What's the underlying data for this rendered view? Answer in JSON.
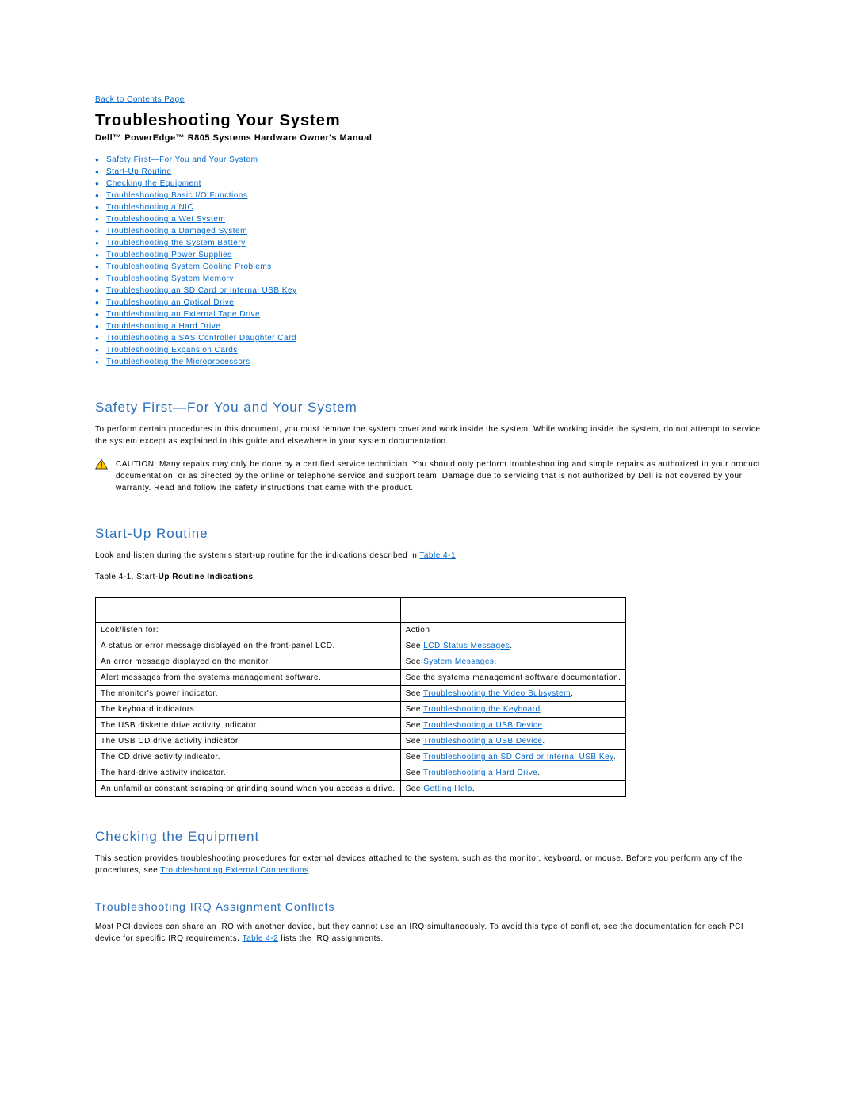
{
  "back_link": "Back to Contents Page",
  "title": "Troubleshooting Your System",
  "subtitle": "Dell™ PowerEdge™ R805 Systems Hardware Owner's Manual",
  "toc": [
    "Safety First—For You and Your System",
    "Start-Up Routine",
    "Checking the Equipment",
    "Troubleshooting Basic I/O Functions",
    "Troubleshooting a NIC",
    "Troubleshooting a Wet System",
    "Troubleshooting a Damaged System",
    "Troubleshooting the System Battery",
    "Troubleshooting Power Supplies",
    "Troubleshooting System Cooling Problems",
    "Troubleshooting System Memory",
    "Troubleshooting an SD Card or Internal USB Key",
    "Troubleshooting an Optical Drive",
    "Troubleshooting an External Tape Drive",
    "Troubleshooting a Hard Drive",
    "Troubleshooting a SAS Controller Daughter Card",
    "Troubleshooting Expansion Cards",
    "Troubleshooting the Microprocessors"
  ],
  "safety": {
    "heading": "Safety First—For You and Your System",
    "para": "To perform certain procedures in this document, you must remove the system cover and work inside the system. While working inside the system, do not attempt to service the system except as explained in this guide and elsewhere in your system documentation.",
    "caution_label": "CAUTION:",
    "caution_body": " Many repairs may only be done by a certified service technician. You should only perform troubleshooting and simple repairs as authorized in your product documentation, or as directed by the online or telephone service and support team. Damage due to servicing that is not authorized by Dell is not covered by your warranty. Read and follow the safety instructions that came with the product."
  },
  "startup": {
    "heading": "Start-Up Routine",
    "para_pre": "Look and listen during the system's start-up routine for the indications described in ",
    "para_link": "Table 4-1",
    "para_post": ".",
    "caption_pre": "Table 4-1. Start-",
    "caption_bold": "Up Routine Indications",
    "col1": "Look/listen for:",
    "col2": "Action",
    "rows": [
      {
        "l": "A status or error message displayed on the front-panel LCD.",
        "a_pre": "See ",
        "a_link": "LCD Status Messages",
        "a_post": "."
      },
      {
        "l": "An error message displayed on the monitor.",
        "a_pre": "See ",
        "a_link": "System Messages",
        "a_post": "."
      },
      {
        "l": "Alert messages from the systems management software.",
        "a_pre": "See the systems management software documentation.",
        "a_link": "",
        "a_post": ""
      },
      {
        "l": "The monitor's power indicator.",
        "a_pre": "See ",
        "a_link": "Troubleshooting the Video Subsystem",
        "a_post": "."
      },
      {
        "l": "The keyboard indicators.",
        "a_pre": "See ",
        "a_link": "Troubleshooting the Keyboard",
        "a_post": "."
      },
      {
        "l": "The USB diskette drive activity indicator.",
        "a_pre": "See ",
        "a_link": "Troubleshooting a USB Device",
        "a_post": "."
      },
      {
        "l": "The USB CD drive activity indicator.",
        "a_pre": "See ",
        "a_link": "Troubleshooting a USB Device",
        "a_post": "."
      },
      {
        "l": "The CD drive activity indicator.",
        "a_pre": "See ",
        "a_link": "Troubleshooting an SD Card or Internal USB Key",
        "a_post": "."
      },
      {
        "l": "The hard-drive activity indicator.",
        "a_pre": "See ",
        "a_link": "Troubleshooting a Hard Drive",
        "a_post": "."
      },
      {
        "l": "An unfamiliar constant scraping or grinding sound when you access a drive.",
        "a_pre": "See ",
        "a_link": "Getting Help",
        "a_post": "."
      }
    ]
  },
  "checking": {
    "heading": "Checking the Equipment",
    "para_pre": "This section provides troubleshooting procedures for external devices attached to the system, such as the monitor, keyboard, or mouse. Before you perform any of the procedures, see ",
    "para_link": "Troubleshooting External Connections",
    "para_post": "."
  },
  "irq": {
    "heading": "Troubleshooting IRQ Assignment Conflicts",
    "para_pre": "Most PCI devices can share an IRQ with another device, but they cannot use an IRQ simultaneously. To avoid this type of conflict, see the documentation for each PCI device for specific IRQ requirements. ",
    "para_link": "Table 4-2",
    "para_post": " lists the IRQ assignments."
  }
}
